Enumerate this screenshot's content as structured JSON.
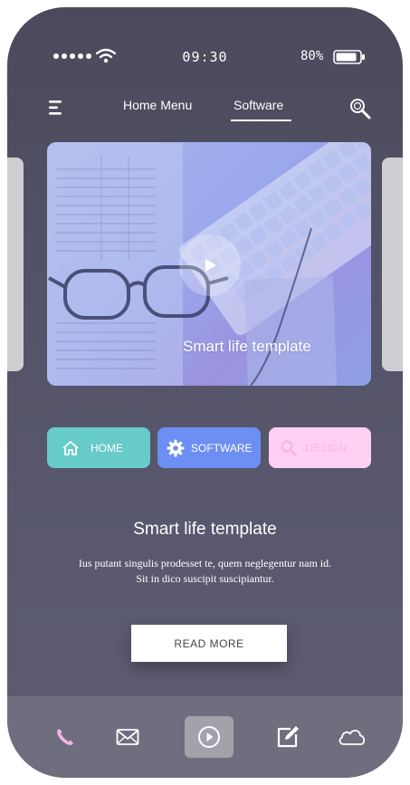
{
  "status": {
    "time": "09:30",
    "battery": "80%"
  },
  "nav": {
    "home_menu": "Home Menu",
    "software": "Software",
    "active": "Software"
  },
  "hero": {
    "caption": "Smart life template"
  },
  "categories": [
    {
      "label": "HOME",
      "icon": "home-icon",
      "color": "#67cbc8"
    },
    {
      "label": "SOFTWARE",
      "icon": "gear-icon",
      "color": "#6d8ff3"
    },
    {
      "label": "DESIGN",
      "icon": "search-icon",
      "color": "#ffd0f3"
    }
  ],
  "content": {
    "title": "Smart life template",
    "body_line1": "Ius putant singulis prodesset te, quem neglegentur nam id.",
    "body_line2": "Sit in dico suscipit suscipiantur.",
    "button": "READ MORE"
  },
  "tabbar": {
    "items": [
      "phone-icon",
      "mail-icon",
      "play-icon",
      "edit-icon",
      "cloud-icon"
    ],
    "active": "play-icon",
    "phone_color": "#f6b3e8"
  }
}
